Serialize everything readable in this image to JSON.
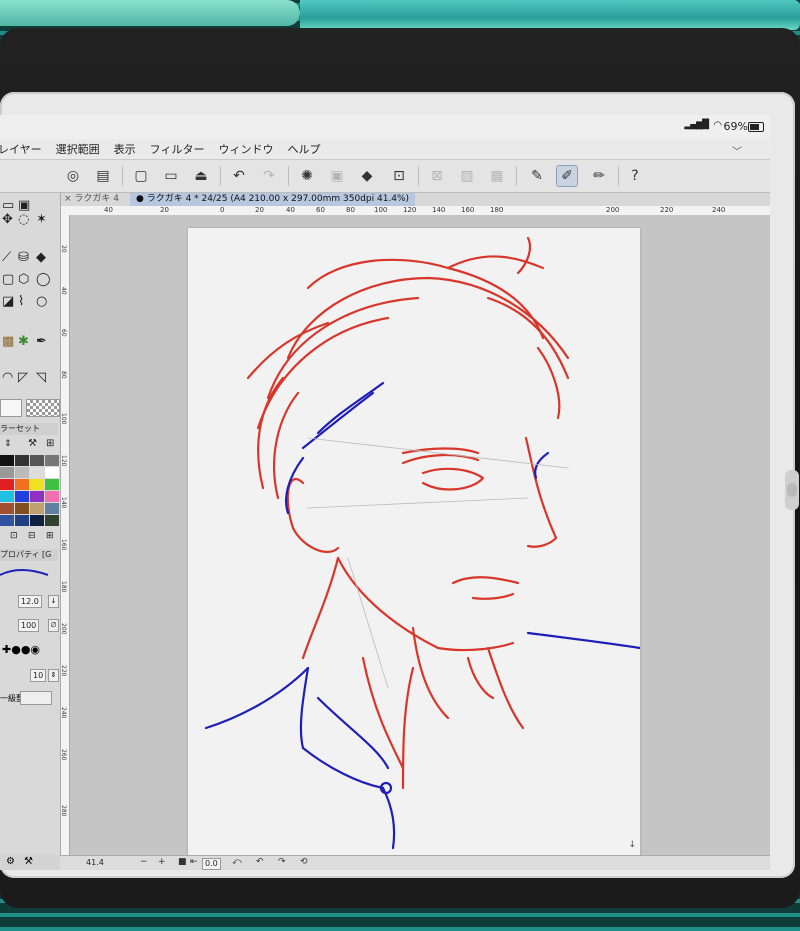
{
  "status": {
    "battery": "69%",
    "signal": "▂▄▆█",
    "wifi": "◠"
  },
  "menu": [
    "レイヤー",
    "選択範囲",
    "表示",
    "フィルター",
    "ウィンドウ",
    "ヘルプ"
  ],
  "tabs": {
    "inactive": "× ラクガキ 4",
    "active": "● ラクガキ 4 * 24/25 (A4 210.00 x 297.00mm 350dpi 41.4%)"
  },
  "ruler_top": [
    "40",
    "20",
    "0",
    "20",
    "40",
    "60",
    "80",
    "100",
    "120",
    "140",
    "160",
    "180",
    "200",
    "220",
    "240"
  ],
  "ruler_left": [
    "20",
    "40",
    "60",
    "80",
    "100",
    "120",
    "140",
    "160",
    "180",
    "200",
    "220",
    "240",
    "260",
    "280"
  ],
  "left_panel": {
    "color_set_title": "ラーセット",
    "property_title": "プロパティ [G",
    "brush_size": "12.0",
    "opacity": "100",
    "stabilization": "10",
    "stabilization_label": "一級整"
  },
  "bottom": {
    "zoom": "41.4",
    "angle": "0.0"
  },
  "colors": {
    "red_line": "#d9362b",
    "blue_line": "#1f1fb8",
    "swatches": [
      "#111111",
      "#333333",
      "#555555",
      "#777777",
      "#999999",
      "#bbbbbb",
      "#dddddd",
      "#ffffff",
      "#e02020",
      "#f07020",
      "#f0e020",
      "#40c040",
      "#20c0e0",
      "#2040e0",
      "#9030c0",
      "#f070b0",
      "#a05030",
      "#805020",
      "#c0a070",
      "#6080a0",
      "#3050a0",
      "#204080",
      "#102040",
      "#304030"
    ]
  },
  "icons": {
    "undo": "undo-icon",
    "redo": "redo-icon",
    "loading": "spinner-icon",
    "fill": "fill-icon",
    "transform": "transform-icon",
    "pen": "pen-icon",
    "help": "help-icon"
  }
}
